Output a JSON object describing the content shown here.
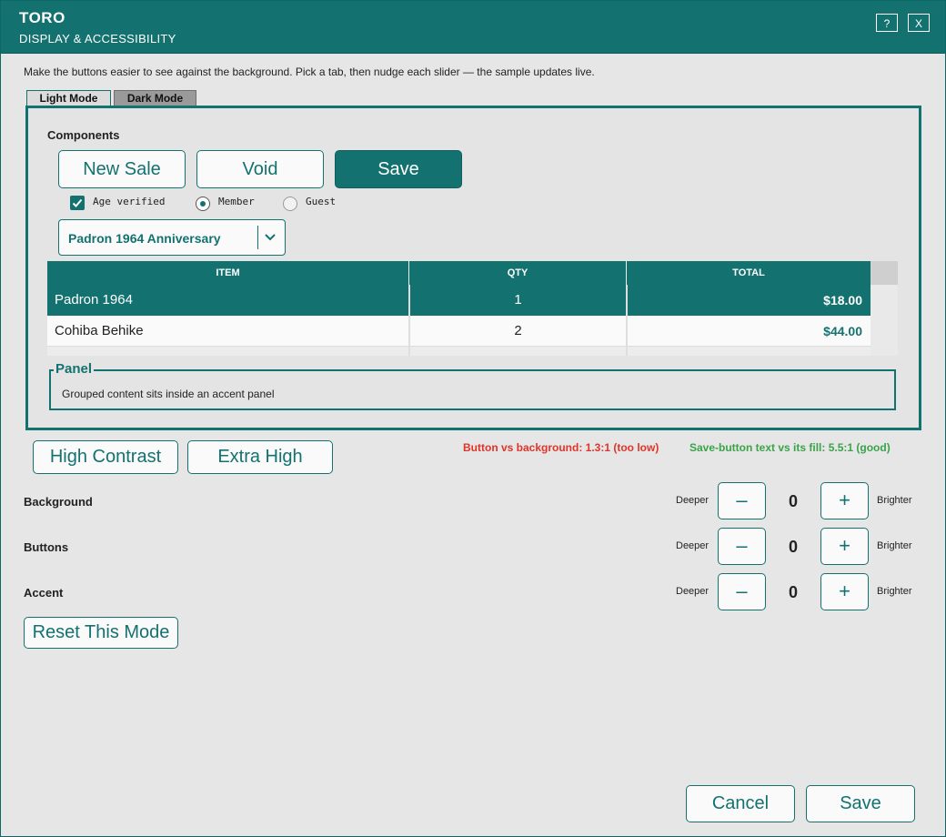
{
  "window": {
    "title": "TORO",
    "subtitle": "DISPLAY & ACCESSIBILITY",
    "help_label": "?",
    "close_label": "X"
  },
  "intro": "Make the buttons easier to see against the background. Pick a tab, then nudge each slider — the sample updates live.",
  "tabs": [
    {
      "label": "Light Mode",
      "active": true
    },
    {
      "label": "Dark Mode",
      "active": false
    }
  ],
  "sample": {
    "components_label": "Components",
    "buttons": [
      "New Sale",
      "Void",
      "Save"
    ],
    "checkbox": {
      "label": "Age verified",
      "checked": true
    },
    "radios": [
      {
        "label": "Member",
        "selected": true
      },
      {
        "label": "Guest",
        "selected": false
      }
    ],
    "select": {
      "value": "Padron 1964 Anniversary"
    },
    "table": {
      "headers": [
        "ITEM",
        "QTY",
        "TOTAL"
      ],
      "rows": [
        {
          "item": "Padron 1964",
          "qty": "1",
          "total": "$18.00",
          "selected": true
        },
        {
          "item": "Cohiba Behike",
          "qty": "2",
          "total": "$44.00",
          "selected": false
        }
      ]
    },
    "panel": {
      "legend": "Panel",
      "text": "Grouped content sits inside an accent panel"
    }
  },
  "presets": [
    "High Contrast",
    "Extra High"
  ],
  "contrast": {
    "warning": "Button vs background: 1.3:1 (too low)",
    "good": "Save-button text vs its fill: 5.5:1 (good)"
  },
  "sliders": [
    {
      "label": "Background",
      "minus_label": "Deeper",
      "value": "0",
      "plus_label": "Brighter"
    },
    {
      "label": "Buttons",
      "minus_label": "Deeper",
      "value": "0",
      "plus_label": "Brighter"
    },
    {
      "label": "Accent",
      "minus_label": "Deeper",
      "value": "0",
      "plus_label": "Brighter"
    }
  ],
  "stepper_symbols": {
    "minus": "–",
    "plus": "+"
  },
  "reset_label": "Reset This Mode",
  "footer": {
    "cancel_label": "Cancel",
    "save_label": "Save"
  },
  "colors": {
    "accent": "#137270",
    "background": "#e6e6e6",
    "warning": "#e0342a",
    "good": "#3aa34a"
  }
}
